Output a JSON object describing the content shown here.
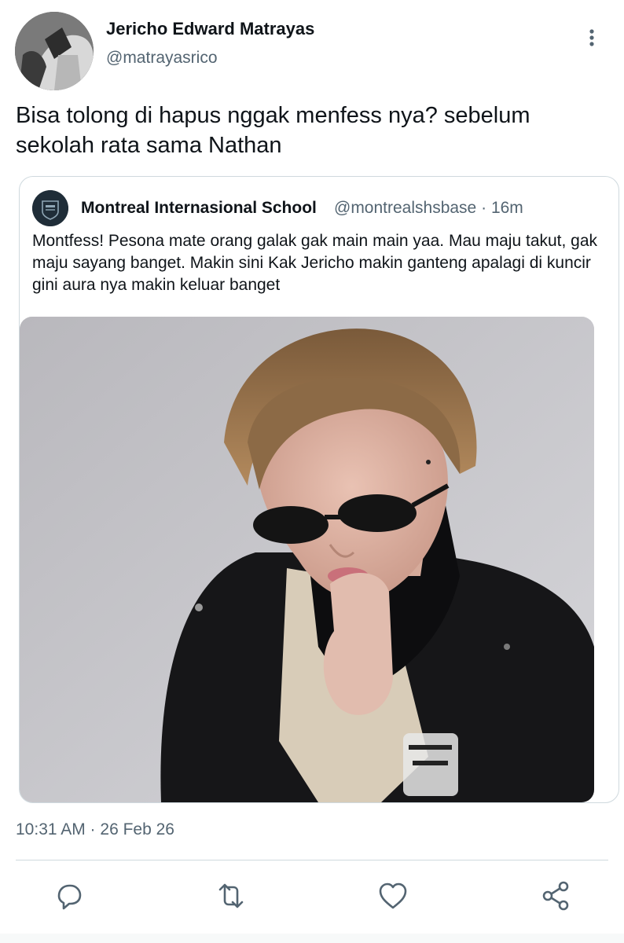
{
  "author": {
    "name": "Jericho Edward Matrayas",
    "handle": "@matrayasrico"
  },
  "tweet": {
    "text": "Bisa tolong di hapus nggak menfess nya? sebelum sekolah rata sama Nathan",
    "timestamp": "10:31 AM · 26 Feb 26"
  },
  "quoted": {
    "name": "Montreal Internasional School",
    "handle": "@montrealshsbase",
    "separator": "·",
    "time": "16m",
    "text": "Montfess! Pesona mate orang galak gak main main yaa. Mau maju takut, gak maju sayang banget. Makin sini Kak Jericho makin ganteng apalagi di kuncir gini aura nya makin keluar banget"
  },
  "icons": {
    "more": "more-vertical-icon",
    "reply": "reply-icon",
    "retweet": "retweet-icon",
    "like": "heart-icon",
    "share": "share-icon"
  },
  "colors": {
    "text_primary": "#0f1419",
    "text_secondary": "#536471",
    "border": "#cfd9de",
    "icon": "#536471"
  }
}
